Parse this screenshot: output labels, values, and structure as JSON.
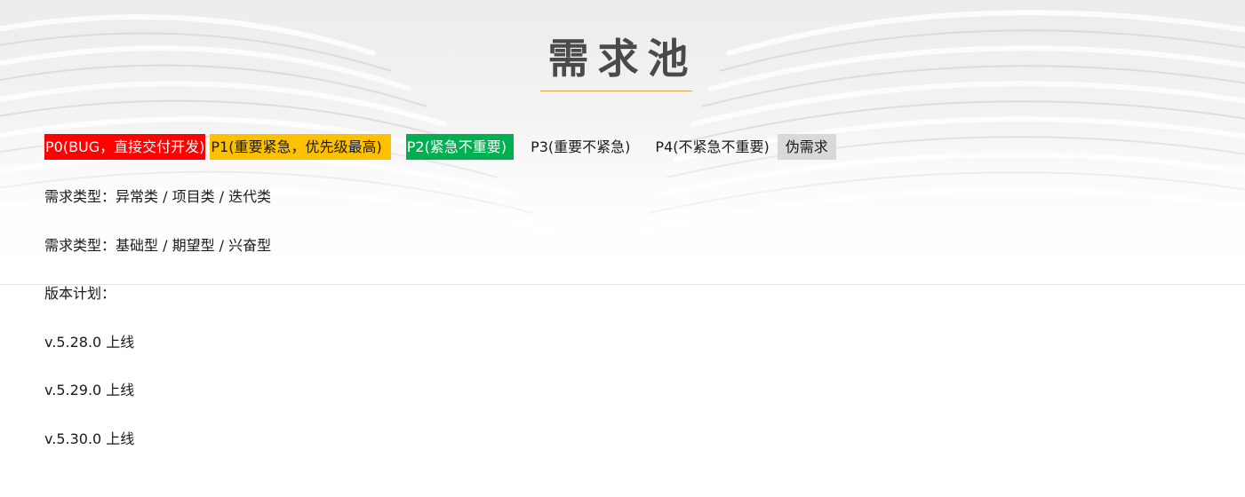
{
  "title": "需求池",
  "priority_legend": {
    "p0": "P0(BUG，直接交付开发)",
    "p1": "P1(重要紧急，优先级最高)",
    "p2": "P2(紧急不重要)",
    "p3": "P3(重要不紧急)",
    "p4": "P4(不紧急不重要)",
    "fake": "伪需求"
  },
  "colors": {
    "p0": "#ff0000",
    "p1": "#ffc000",
    "p2": "#00b050",
    "fake": "#d9d9d9",
    "title_underline": "#d9a441"
  },
  "demand_type_1": "需求类型：异常类 / 项目类 / 迭代类",
  "demand_type_2": "需求类型：基础型 / 期望型 / 兴奋型",
  "version_plan_label": "版本计划：",
  "versions": [
    "v.5.28.0  上线",
    "v.5.29.0  上线",
    "v.5.30.0  上线"
  ]
}
